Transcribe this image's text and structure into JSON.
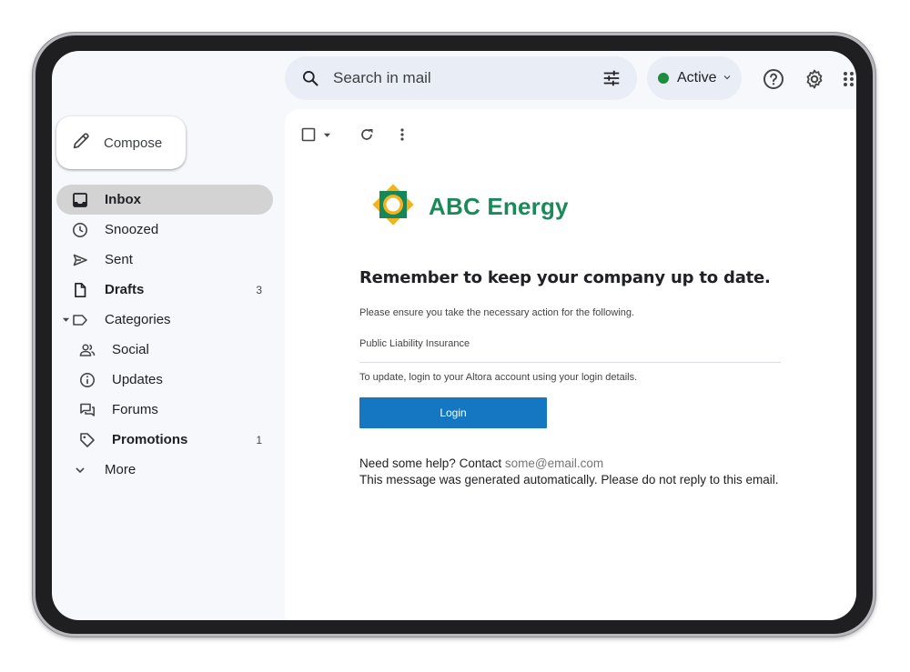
{
  "search": {
    "text": "Search in mail"
  },
  "status": {
    "label": "Active",
    "color": "#1e8e3e"
  },
  "compose": {
    "label": "Compose"
  },
  "sidebar": {
    "items": [
      {
        "label": "Inbox",
        "count": ""
      },
      {
        "label": "Snoozed",
        "count": ""
      },
      {
        "label": "Sent",
        "count": ""
      },
      {
        "label": "Drafts",
        "count": "3"
      },
      {
        "label": "Categories",
        "count": ""
      },
      {
        "label": "Social",
        "count": ""
      },
      {
        "label": "Updates",
        "count": ""
      },
      {
        "label": "Forums",
        "count": ""
      },
      {
        "label": "Promotions",
        "count": "1"
      },
      {
        "label": "More",
        "count": ""
      }
    ]
  },
  "email": {
    "brand": "ABC Energy",
    "brand_color": "#1a8a5a",
    "heading": "Remember to keep your company up to date.",
    "intro": "Please ensure you take the necessary action for the following.",
    "item": "Public Liability Insurance",
    "update_text": "To update, login to your Altora account using your login details.",
    "button_label": "Login",
    "button_color": "#1576c2",
    "help_prefix": "Need some help? Contact",
    "help_email": "some@email.com",
    "footer": "This message was generated automatically. Please do not reply to this email."
  }
}
